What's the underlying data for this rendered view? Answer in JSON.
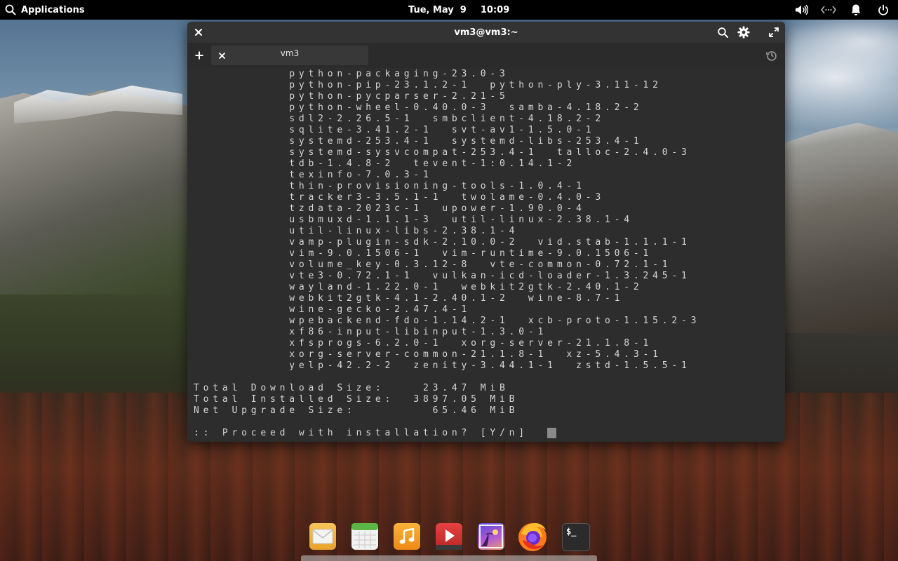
{
  "top_panel": {
    "applications_label": "Applications",
    "clock_date": "Tue, May  9",
    "clock_time": "10:09",
    "indicator_icons": [
      "volume-icon",
      "network-icon",
      "notification-icon",
      "power-icon"
    ]
  },
  "terminal": {
    "title": "vm3@vm3:~",
    "tab_label": "vm3",
    "lines": [
      "          python-packaging-23.0-3",
      "          python-pip-23.1.2-1  python-ply-3.11-12",
      "          python-pycparser-2.21-5",
      "          python-wheel-0.40.0-3  samba-4.18.2-2",
      "          sdl2-2.26.5-1  smbclient-4.18.2-2",
      "          sqlite-3.41.2-1  svt-av1-1.5.0-1",
      "          systemd-253.4-1  systemd-libs-253.4-1",
      "          systemd-sysvcompat-253.4-1  talloc-2.4.0-3",
      "          tdb-1.4.8-2  tevent-1:0.14.1-2",
      "          texinfo-7.0.3-1",
      "          thin-provisioning-tools-1.0.4-1",
      "          tracker3-3.5.1-1  twolame-0.4.0-3",
      "          tzdata-2023c-1  upower-1.90.0-4",
      "          usbmuxd-1.1.1-3  util-linux-2.38.1-4",
      "          util-linux-libs-2.38.1-4",
      "          vamp-plugin-sdk-2.10.0-2  vid.stab-1.1.1-1",
      "          vim-9.0.1506-1  vim-runtime-9.0.1506-1",
      "          volume_key-0.3.12-8  vte-common-0.72.1-1",
      "          vte3-0.72.1-1  vulkan-icd-loader-1.3.245-1",
      "          wayland-1.22.0-1  webkit2gtk-2.40.1-2",
      "          webkit2gtk-4.1-2.40.1-2  wine-8.7-1",
      "          wine-gecko-2.47.4-1",
      "          wpebackend-fdo-1.14.2-1  xcb-proto-1.15.2-3",
      "          xf86-input-libinput-1.3.0-1",
      "          xfsprogs-6.2.0-1  xorg-server-21.1.8-1",
      "          xorg-server-common-21.1.8-1  xz-5.4.3-1",
      "          yelp-42.2-2  zenity-3.44.1-1  zstd-1.5.5-1",
      "",
      "Total Download Size:    23.47 MiB",
      "Total Installed Size:  3897.05 MiB",
      "Net Upgrade Size:        65.46 MiB",
      "",
      ":: Proceed with installation? [Y/n] "
    ]
  },
  "dock": {
    "items": [
      {
        "name": "mail-app-icon",
        "color": "#f2b33d"
      },
      {
        "name": "calendar-app-icon",
        "color": "#6cc04a"
      },
      {
        "name": "music-app-icon",
        "color": "#f39a23"
      },
      {
        "name": "videos-app-icon",
        "color": "#d93434"
      },
      {
        "name": "photos-app-icon",
        "color": "#8a5bd0"
      },
      {
        "name": "firefox-app-icon",
        "color": "#ff7a1a"
      },
      {
        "name": "terminal-app-icon",
        "color": "#2b2b2b"
      }
    ]
  }
}
